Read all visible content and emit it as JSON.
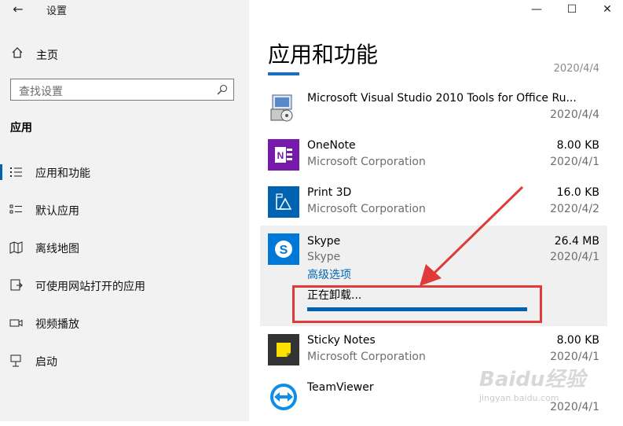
{
  "window": {
    "title": "设置",
    "back_icon": "arrow-left-icon"
  },
  "caption_buttons": [
    "minimize-icon",
    "maximize-icon",
    "close-icon"
  ],
  "sidebar": {
    "home_label": "主页",
    "search_placeholder": "查找设置",
    "section_title": "应用",
    "items": [
      {
        "label": "应用和功能",
        "icon": "apps-features-icon",
        "selected": true
      },
      {
        "label": "默认应用",
        "icon": "default-apps-icon"
      },
      {
        "label": "离线地图",
        "icon": "offline-maps-icon"
      },
      {
        "label": "可使用网站打开的应用",
        "icon": "apps-for-websites-icon"
      },
      {
        "label": "视频播放",
        "icon": "video-playback-icon"
      },
      {
        "label": "启动",
        "icon": "startup-icon"
      }
    ]
  },
  "main": {
    "title": "应用和功能",
    "partial_item_date": "2020/4/4",
    "apps": [
      {
        "name": "Microsoft Visual Studio 2010 Tools for Office Ru...",
        "publisher": "",
        "size": "",
        "date": "2020/4/4",
        "icon": "installer-icon"
      },
      {
        "name": "OneNote",
        "publisher": "Microsoft Corporation",
        "size": "8.00 KB",
        "date": "2020/4/1",
        "icon": "onenote-icon",
        "color": "#7719aa"
      },
      {
        "name": "Print 3D",
        "publisher": "Microsoft Corporation",
        "size": "16.0 KB",
        "date": "2020/4/2",
        "icon": "print3d-icon",
        "color": "#0063b1"
      },
      {
        "name": "Skype",
        "publisher": "Skype",
        "size": "26.4 MB",
        "date": "2020/4/1",
        "icon": "skype-icon",
        "color": "#0078d7",
        "advanced_options": "高级选项",
        "status": "正在卸载...",
        "progress": 1.0
      },
      {
        "name": "Sticky Notes",
        "publisher": "Microsoft Corporation",
        "size": "8.00 KB",
        "date": "2020/4/1",
        "icon": "sticky-notes-icon",
        "color": "#333333"
      },
      {
        "name": "TeamViewer",
        "publisher": "",
        "size": "",
        "date": "2020/4/1",
        "icon": "teamviewer-icon",
        "color": "#0e8ee9"
      }
    ]
  },
  "watermark": {
    "brand": "Baidu经验",
    "url": "jingyan.baidu.com"
  },
  "colors": {
    "accent": "#0063b1",
    "annotation": "#e03a3a"
  }
}
